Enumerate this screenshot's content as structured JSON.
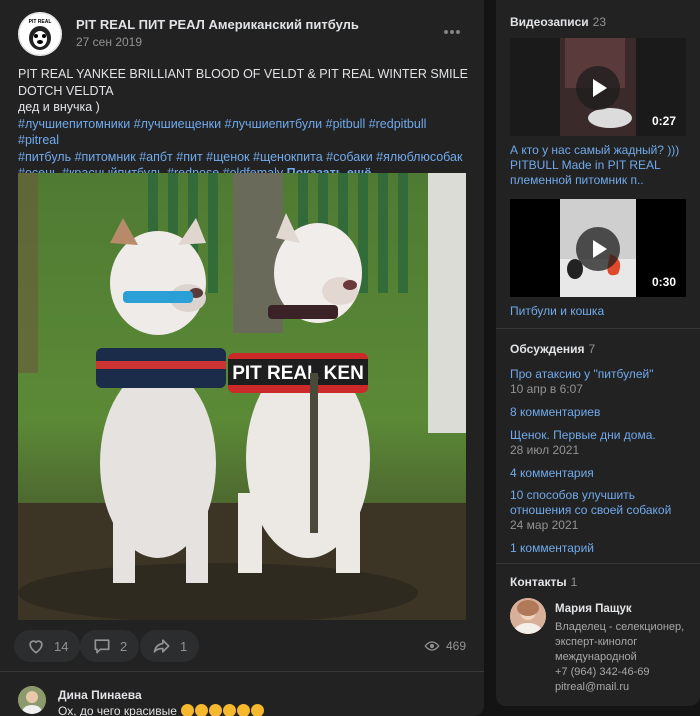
{
  "post": {
    "author": "PIT REAL ПИТ РЕАЛ Американский питбуль",
    "date": "27 сен 2019",
    "avatar_text": "PIT REAL",
    "title_line": "PIT REAL YANKEE BRILLIANT BLOOD OF VELDT & PIT REAL WINTER SMILE DOTCH VELDTA",
    "subtitle_line": "дед и внучка )",
    "tags_line1": "#лучшиепитомники #лучшиещенки #лучшиепитбули #pitbull #redpitbull #pitreal",
    "tags_line2": "#питбуль #питомник #апбт #пит #щенок #щенокпита #собаки #ялюблюсобак",
    "tags_line3": "#осень #красныйпитбуль #rednose #oldfemaly",
    "show_more": "Показать ещё",
    "harness_text": "PIT REAL KEN",
    "likes": "14",
    "comments": "2",
    "shares": "1",
    "views": "469"
  },
  "comment": {
    "author": "Дина Пинаева",
    "text": "Ох, до чего красивые"
  },
  "sidebar": {
    "videos": {
      "title": "Видеозаписи",
      "count": "23",
      "items": [
        {
          "title": "А кто у нас самый жадный? ))) PITBULL Made in PIT REAL племенной питомник п..",
          "duration": "0:27"
        },
        {
          "title": "Питбули и кошка",
          "duration": "0:30"
        }
      ]
    },
    "discussions": {
      "title": "Обсуждения",
      "count": "7",
      "items": [
        {
          "title": "Про атаксию у \"питбулей\"",
          "date": "10 апр в 6:07",
          "comments": "8 комментариев"
        },
        {
          "title": "Щенок. Первые дни дома.",
          "date": "28 июл 2021",
          "comments": "4 комментария"
        },
        {
          "title": "10 способов улучшить отношения со своей собакой",
          "date": "24 мар 2021",
          "comments": "1 комментарий"
        }
      ]
    },
    "contacts": {
      "title": "Контакты",
      "count": "1",
      "name": "Мария Пащук",
      "role": "Владелец - селекционер, эксперт-кинолог международной",
      "phone": "+7 (964) 342-46-69",
      "email": "pitreal@mail.ru"
    }
  },
  "colors": {
    "background": "#141414",
    "card": "#222222",
    "link": "#71aaeb",
    "text": "#e1e3e6",
    "muted": "#939393"
  }
}
